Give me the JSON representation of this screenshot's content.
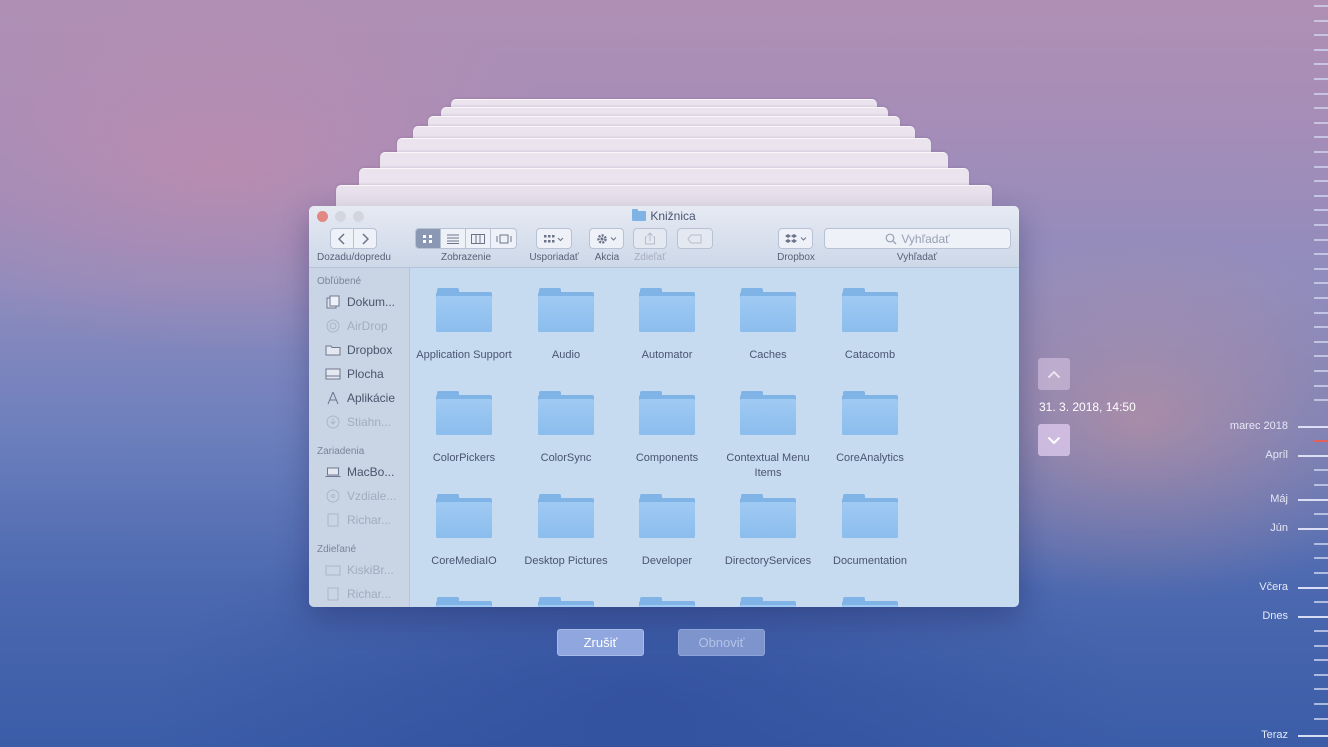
{
  "window": {
    "title": "Knižnica"
  },
  "toolbar": {
    "nav_label": "Dozadu/dopredu",
    "view_label": "Zobrazenie",
    "arrange_label": "Usporiadať",
    "action_label": "Akcia",
    "share_label": "Zdieľať",
    "dropbox_label": "Dropbox",
    "search_label": "Vyhľadať",
    "search_placeholder": "Vyhľadať"
  },
  "sidebar": {
    "favorites_heading": "Obľúbené",
    "favorites": [
      {
        "label": "Dokum...",
        "icon": "documents-icon"
      },
      {
        "label": "AirDrop",
        "icon": "airdrop-icon"
      },
      {
        "label": "Dropbox",
        "icon": "folder-icon"
      },
      {
        "label": "Plocha",
        "icon": "desktop-icon"
      },
      {
        "label": "Aplikácie",
        "icon": "applications-icon"
      },
      {
        "label": "Stiahn...",
        "icon": "downloads-icon"
      }
    ],
    "devices_heading": "Zariadenia",
    "devices": [
      {
        "label": "MacBo...",
        "icon": "laptop-icon"
      },
      {
        "label": "Vzdiale...",
        "icon": "remote-disc-icon"
      },
      {
        "label": "Richar...",
        "icon": "disk-icon"
      }
    ],
    "shared_heading": "Zdieľané",
    "shared": [
      {
        "label": "KiskiBr...",
        "icon": "shared-computer-icon"
      },
      {
        "label": "Richar...",
        "icon": "shared-computer-icon"
      }
    ]
  },
  "folders": [
    [
      "Application Support",
      "Audio",
      "Automator",
      "Caches",
      "Catacomb"
    ],
    [
      "ColorPickers",
      "ColorSync",
      "Components",
      "Contextual Menu Items",
      "CoreAnalytics"
    ],
    [
      "CoreMediaIO",
      "Desktop Pictures",
      "Developer",
      "DirectoryServices",
      "Documentation"
    ]
  ],
  "timemachine": {
    "current_date": "31. 3. 2018, 14:50",
    "cancel_label": "Zrušiť",
    "restore_label": "Obnoviť",
    "timeline_labels": {
      "march": "marec 2018",
      "april": "Apríl",
      "may": "Máj",
      "june": "Jún",
      "yesterday": "Včera",
      "today": "Dnes",
      "now": "Teraz"
    }
  },
  "colors": {
    "folder_blue": "#8bbded",
    "finder_background": "#c6daf0",
    "timeline_marker": "#e4605e"
  }
}
